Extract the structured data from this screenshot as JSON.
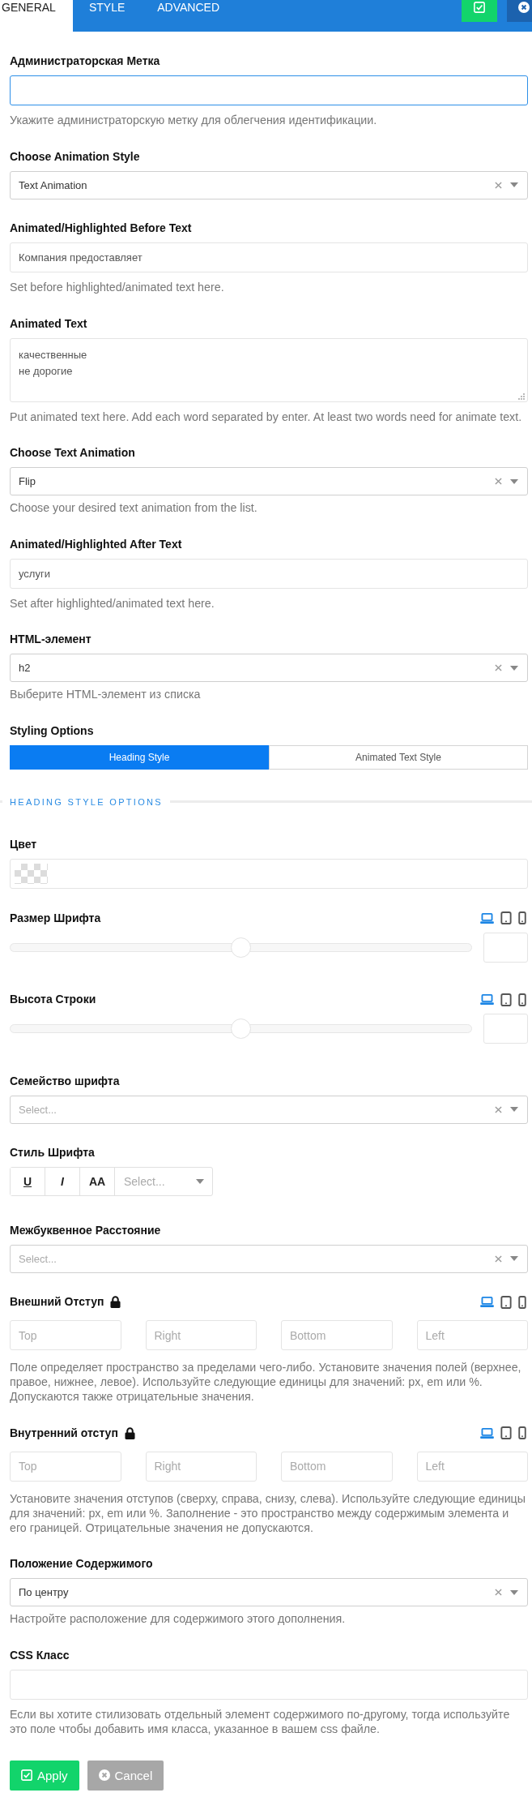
{
  "tabs": [
    {
      "label": "GENERAL",
      "selected": true
    },
    {
      "label": "STYLE",
      "selected": false
    },
    {
      "label": "ADVANCED",
      "selected": false
    }
  ],
  "header_buttons": [
    {
      "kind": "save"
    },
    {
      "kind": "close"
    }
  ],
  "fields": [
    {
      "kind": "text",
      "label": "Администраторская Метка",
      "focused": true,
      "help": "Укажите администраторскую метку для облегчения идентификации."
    },
    {
      "kind": "select",
      "label": "Choose Animation Style",
      "value": "Text Animation"
    },
    {
      "kind": "text",
      "label": "Animated/Highlighted Before Text",
      "value": "Компания предоставляет",
      "focused": false,
      "help": "Set before highlighted/animated text here."
    },
    {
      "kind": "textarea",
      "label": "Animated Text",
      "value": "качественные\nне дорогие",
      "help": "Put animated text here. Add each word separated by enter. At least two words need for animate text."
    },
    {
      "kind": "select",
      "label": "Choose Text Animation",
      "value": "Flip",
      "help": "Choose your desired text animation from the list."
    },
    {
      "kind": "text",
      "label": "Animated/Highlighted After Text",
      "value": "услуги",
      "focused": false,
      "help": "Set after highlighted/animated text here."
    },
    {
      "kind": "select",
      "label": "HTML-элемент",
      "value": "h2",
      "help": "Выберите HTML-элемент из списка"
    },
    {
      "kind": "segmented",
      "label": "Styling Options",
      "options": [
        {
          "label": "Heading Style",
          "selected": true
        },
        {
          "label": "Animated Text Style",
          "selected": false
        }
      ]
    },
    {
      "kind": "section",
      "title": "HEADING STYLE OPTIONS"
    },
    {
      "kind": "color",
      "label": "Цвет"
    },
    {
      "kind": "slider",
      "label": "Размер Шрифта",
      "level": 0.5,
      "devices": [
        {
          "kind": "desktop",
          "selected": true
        },
        {
          "kind": "tablet",
          "selected": false
        },
        {
          "kind": "phone",
          "selected": false
        }
      ]
    },
    {
      "kind": "slider",
      "label": "Высота Строки",
      "level": 0.5,
      "devices": [
        {
          "kind": "desktop",
          "selected": true
        },
        {
          "kind": "tablet",
          "selected": false
        },
        {
          "kind": "phone",
          "selected": false
        }
      ]
    },
    {
      "kind": "select",
      "label": "Семейство шрифта",
      "placeholder": "Select..."
    },
    {
      "kind": "font_style",
      "label": "Стиль Шрифта",
      "buttons": [
        {
          "kind": "underline",
          "label": "U"
        },
        {
          "kind": "italic",
          "label": "I"
        },
        {
          "kind": "caps",
          "label": "AA"
        }
      ],
      "placeholder": "Select..."
    },
    {
      "kind": "select",
      "label": "Межбуквенное Расстояние",
      "placeholder": "Select..."
    },
    {
      "kind": "spacing",
      "label": "Внешний Отступ",
      "locked": true,
      "devices": [
        {
          "kind": "desktop",
          "selected": true
        },
        {
          "kind": "tablet",
          "selected": false
        },
        {
          "kind": "phone",
          "selected": false
        }
      ],
      "inputs": [
        {
          "placeholder": "Top"
        },
        {
          "placeholder": "Right"
        },
        {
          "placeholder": "Bottom"
        },
        {
          "placeholder": "Left"
        }
      ],
      "help": "Поле определяет пространство за пределами чего-либо. Установите значения полей (верхнее, правое, нижнее, левое). Используйте следующие единицы для значений: px, em или %. Допускаются также отрицательные значения."
    },
    {
      "kind": "spacing",
      "label": "Внутренний отступ",
      "locked": true,
      "devices": [
        {
          "kind": "desktop",
          "selected": true
        },
        {
          "kind": "tablet",
          "selected": false
        },
        {
          "kind": "phone",
          "selected": false
        }
      ],
      "inputs": [
        {
          "placeholder": "Top"
        },
        {
          "placeholder": "Right"
        },
        {
          "placeholder": "Bottom"
        },
        {
          "placeholder": "Left"
        }
      ],
      "help": "Установите значения отступов (сверху, справа, снизу, слева). Используйте следующие единицы для значений: px, em или %. Заполнение - это пространство между содержимым элемента и его границей. Отрицательные значения не допускаются."
    },
    {
      "kind": "select",
      "label": "Положение Содержимого",
      "value": "По центру",
      "help": "Настройте расположение для содержимого этого дополнения."
    },
    {
      "kind": "text",
      "label": "CSS Класс",
      "focused": false,
      "help": "Если вы хотите стилизовать отдельный элемент содержимого по-другому, тогда используйте это поле чтобы добавить имя класса, указанное в вашем css файле."
    }
  ],
  "actions": [
    {
      "kind": "apply",
      "label": "Apply"
    },
    {
      "kind": "cancel",
      "label": "Cancel"
    }
  ]
}
